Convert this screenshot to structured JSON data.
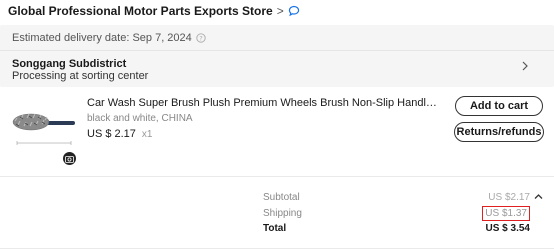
{
  "store": {
    "name": "Global Professional Motor Parts Exports Store",
    "chevron": ">"
  },
  "delivery": {
    "estimated": "Estimated delivery date: Sep 7, 2024",
    "location": "Songgang Subdistrict",
    "status": "Processing at sorting center"
  },
  "product": {
    "title": "Car Wash Super Brush Plush Premium Wheels Brush Non-Slip Handle Easy To Cleaning Ri...",
    "variant": "black and white, CHINA",
    "price": "US $ 2.17",
    "qty": "x1"
  },
  "actions": {
    "add_to_cart": "Add to cart",
    "returns": "Returns/refunds"
  },
  "summary": {
    "subtotal_label": "Subtotal",
    "subtotal_value": "US $2.17",
    "shipping_label": "Shipping",
    "shipping_value": "US $1.37",
    "total_label": "Total",
    "total_value": "US $ 3.54"
  },
  "colors": {
    "highlight": "#e02020",
    "panel_bg": "#f5f5f5",
    "chat_blue": "#1a73e8"
  },
  "icons": [
    "chat-icon",
    "help-icon",
    "chevron-right-icon",
    "camera-icon",
    "chevron-up-icon"
  ]
}
